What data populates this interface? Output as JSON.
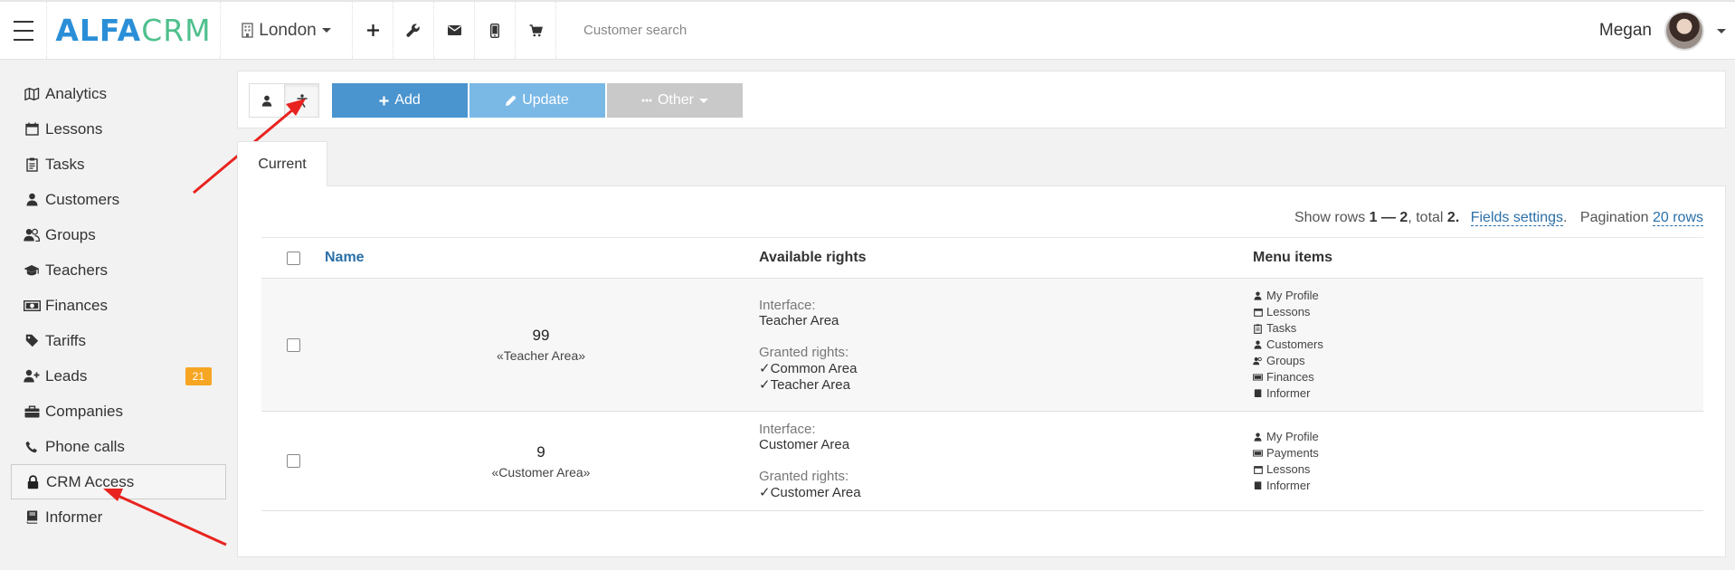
{
  "header": {
    "logo_alfa": "ALFA",
    "logo_crm": "CRM",
    "branch": "London",
    "search_placeholder": "Customer search",
    "user_name": "Megan"
  },
  "sidebar": {
    "items": [
      {
        "label": "Analytics",
        "icon": "map-icon"
      },
      {
        "label": "Lessons",
        "icon": "calendar-icon"
      },
      {
        "label": "Tasks",
        "icon": "clipboard-icon"
      },
      {
        "label": "Customers",
        "icon": "user-icon"
      },
      {
        "label": "Groups",
        "icon": "users-icon"
      },
      {
        "label": "Teachers",
        "icon": "graduation-cap-icon"
      },
      {
        "label": "Finances",
        "icon": "money-icon"
      },
      {
        "label": "Tariffs",
        "icon": "tag-icon"
      },
      {
        "label": "Leads",
        "icon": "user-plus-icon",
        "badge": "21"
      },
      {
        "label": "Companies",
        "icon": "briefcase-icon"
      },
      {
        "label": "Phone calls",
        "icon": "phone-icon"
      },
      {
        "label": "CRM Access",
        "icon": "lock-icon",
        "active": true
      },
      {
        "label": "Informer",
        "icon": "book-icon"
      }
    ]
  },
  "toolbar": {
    "add_label": "Add",
    "update_label": "Update",
    "other_label": "Other"
  },
  "tabs": {
    "current": "Current"
  },
  "table_meta": {
    "show_rows": "Show rows",
    "range": "1 — 2",
    "total_text": ", total",
    "total": "2.",
    "fields_settings": "Fields settings",
    "pagination_label": "Pagination",
    "pagination_value": "20 rows"
  },
  "table": {
    "headers": {
      "name": "Name",
      "rights": "Available rights",
      "menu": "Menu items"
    },
    "interface_label": "Interface:",
    "granted_label": "Granted rights:",
    "rows": [
      {
        "number": "99",
        "title": "«Teacher Area»",
        "interface": "Teacher Area",
        "granted": [
          "Common Area",
          "Teacher Area"
        ],
        "menu": [
          {
            "label": "My Profile",
            "icon": "user-icon"
          },
          {
            "label": "Lessons",
            "icon": "calendar-icon"
          },
          {
            "label": "Tasks",
            "icon": "clipboard-icon"
          },
          {
            "label": "Customers",
            "icon": "user-icon"
          },
          {
            "label": "Groups",
            "icon": "users-icon"
          },
          {
            "label": "Finances",
            "icon": "money-icon"
          },
          {
            "label": "Informer",
            "icon": "book-icon"
          }
        ]
      },
      {
        "number": "9",
        "title": "«Customer Area»",
        "interface": "Customer Area",
        "granted": [
          "Customer Area"
        ],
        "menu": [
          {
            "label": "My Profile",
            "icon": "user-icon"
          },
          {
            "label": "Payments",
            "icon": "money-icon"
          },
          {
            "label": "Lessons",
            "icon": "calendar-icon"
          },
          {
            "label": "Informer",
            "icon": "book-icon"
          }
        ]
      }
    ]
  },
  "colors": {
    "brand_blue": "#2b8fd8",
    "brand_green": "#4fc08d",
    "add_button": "#4a94cf",
    "update_button": "#7ab8e6",
    "other_button": "#c9c9c9",
    "badge": "#f6a623",
    "annotation_arrow": "#e8231f"
  }
}
